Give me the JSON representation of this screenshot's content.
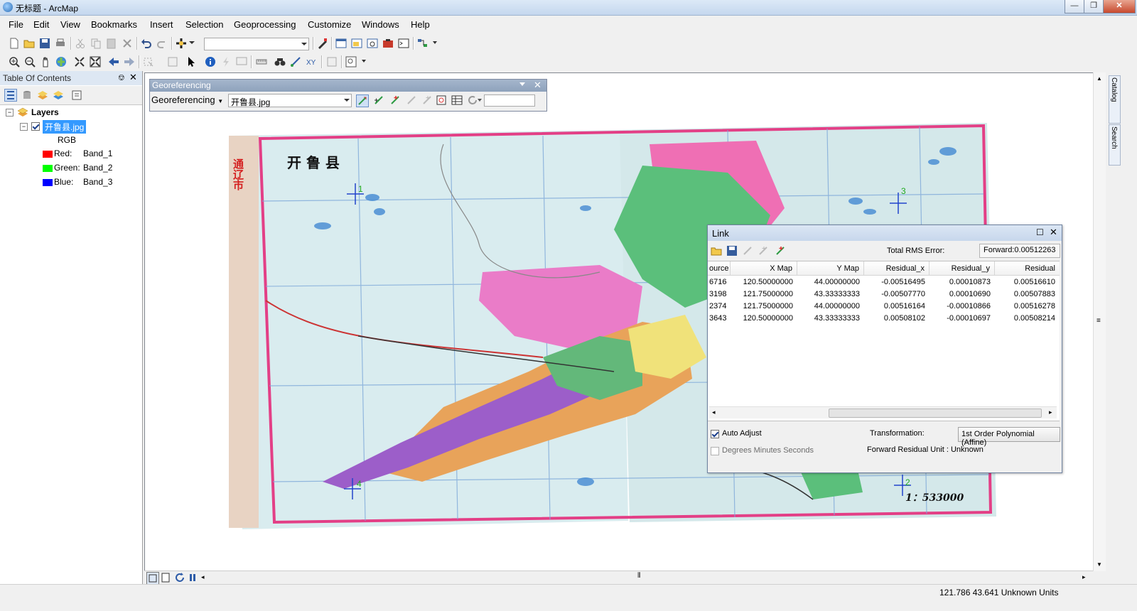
{
  "window": {
    "title": "无标题 - ArcMap"
  },
  "menu": [
    "File",
    "Edit",
    "View",
    "Bookmarks",
    "Insert",
    "Selection",
    "Geoprocessing",
    "Customize",
    "Windows",
    "Help"
  ],
  "toc": {
    "title": "Table Of Contents",
    "root": "Layers",
    "layer": "开鲁县.jpg",
    "render": "RGB",
    "bands": [
      {
        "label": "Red:",
        "band": "Band_1",
        "color": "#ff0000"
      },
      {
        "label": "Green:",
        "band": "Band_2",
        "color": "#00ff00"
      },
      {
        "label": "Blue:",
        "band": "Band_3",
        "color": "#0000ff"
      }
    ]
  },
  "georef": {
    "title": "Georeferencing",
    "menu_label": "Georeferencing",
    "layer_select": "开鲁县.jpg"
  },
  "map": {
    "title": "开 鲁 县",
    "side_text": "通辽市",
    "scale": "1：533000",
    "points": [
      "1",
      "2",
      "3",
      "4"
    ]
  },
  "link": {
    "title": "Link",
    "rms_label": "Total RMS Error:",
    "rms_value": "Forward:0.00512263",
    "columns": [
      "ource",
      "X Map",
      "Y Map",
      "Residual_x",
      "Residual_y",
      "Residual"
    ],
    "rows": [
      [
        "6716",
        "120.50000000",
        "44.00000000",
        "-0.00516495",
        "0.00010873",
        "0.00516610"
      ],
      [
        "3198",
        "121.75000000",
        "43.33333333",
        "-0.00507770",
        "0.00010690",
        "0.00507883"
      ],
      [
        "2374",
        "121.75000000",
        "44.00000000",
        "0.00516164",
        "-0.00010866",
        "0.00516278"
      ],
      [
        "3643",
        "120.50000000",
        "43.33333333",
        "0.00508102",
        "-0.00010697",
        "0.00508214"
      ]
    ],
    "auto_adjust": "Auto Adjust",
    "auto_adjust_checked": true,
    "dms": "Degrees Minutes Seconds",
    "dms_checked": false,
    "transformation_label": "Transformation:",
    "transformation_value": "1st Order Polynomial (Affine)",
    "residual_unit": "Forward Residual Unit : Unknown"
  },
  "dock": {
    "catalog": "Catalog",
    "search": "Search"
  },
  "status": {
    "coords": "121.786  43.641 Unknown Units"
  }
}
